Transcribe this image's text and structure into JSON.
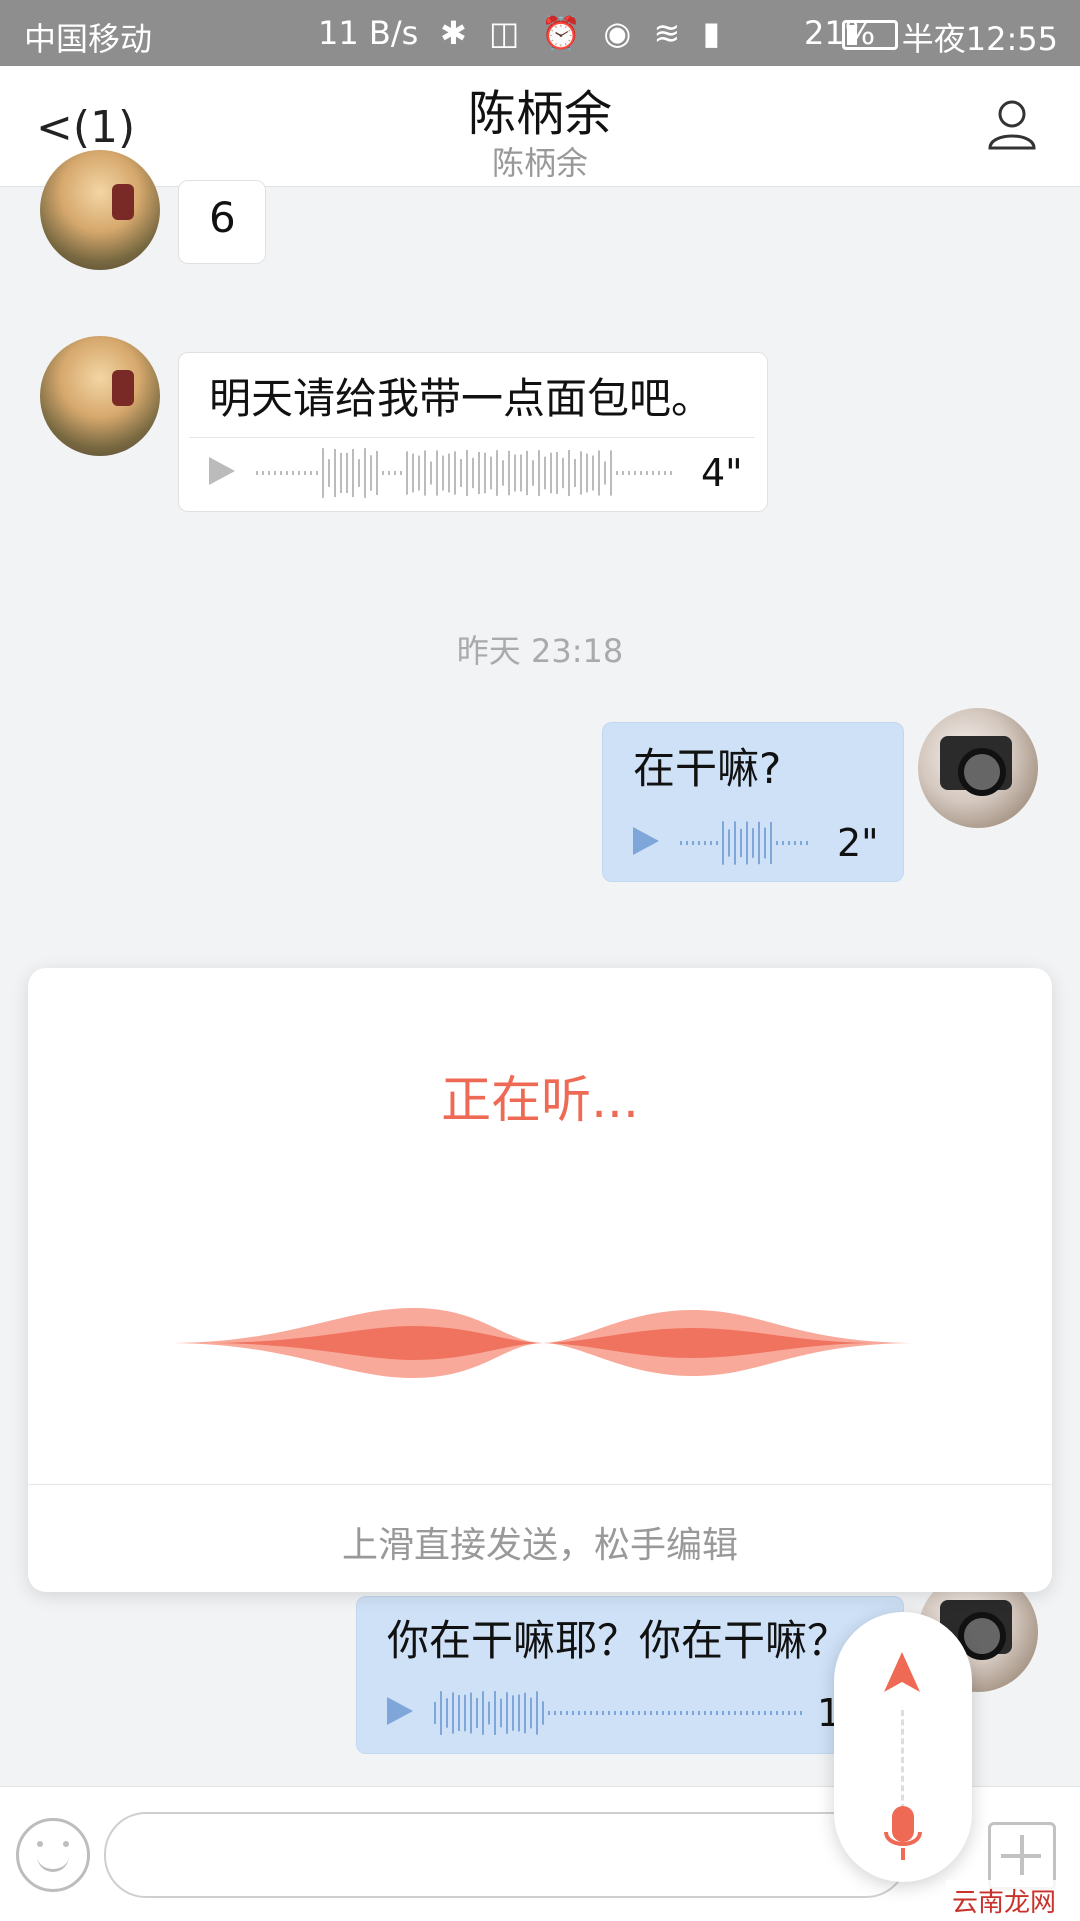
{
  "status_bar": {
    "carrier": "中国移动",
    "network_speed": "11 B/s",
    "battery_percent": "21%",
    "time": "半夜12:55"
  },
  "header": {
    "back_label": "<(1)",
    "title": "陈柄余",
    "subtitle": "陈柄余"
  },
  "messages": [
    {
      "side": "in",
      "text": "6"
    },
    {
      "side": "in",
      "text": "明天请给我带一点面包吧。",
      "duration": "4\""
    },
    {
      "side": "out",
      "text": "在干嘛?",
      "duration": "2\""
    },
    {
      "side": "out",
      "text": "你在干嘛耶？你在干嘛？",
      "duration": "1"
    }
  ],
  "timestamp": "昨天 23:18",
  "voice_panel": {
    "status": "正在听...",
    "hint": "上滑直接发送，松手编辑"
  },
  "watermark": "云南龙网",
  "colors": {
    "accent": "#ef6a55",
    "outgoing_bubble": "#cfe1f7",
    "background": "#f1f3f5"
  }
}
